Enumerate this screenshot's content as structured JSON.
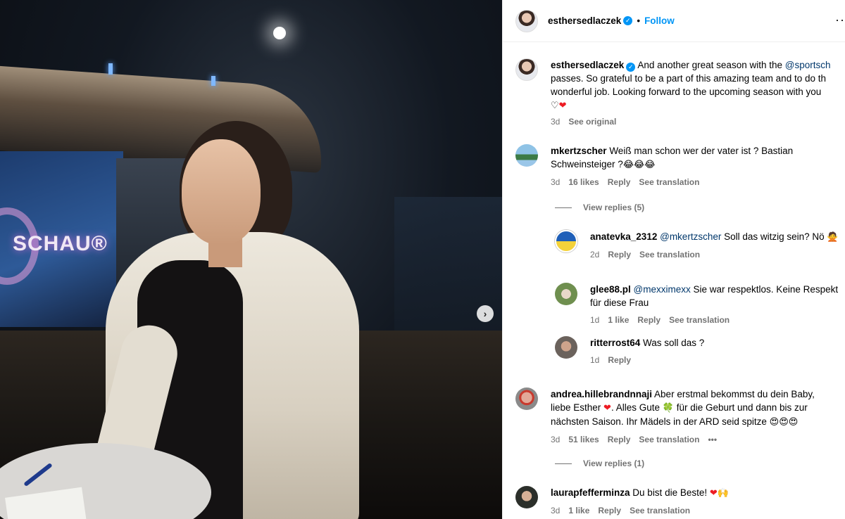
{
  "post": {
    "author": "esthersedlaczek",
    "follow_label": "Follow",
    "dot": "•",
    "more": "···",
    "next_arrow": "›"
  },
  "photo": {
    "logo_text": "SCHAU®"
  },
  "caption": {
    "username": "esthersedlaczek",
    "text_1": "And another great season with the ",
    "mention": "@sportsch",
    "text_2": "passes. So grateful to be a part of this amazing team and to do th",
    "text_3": "wonderful job. Looking forward to the upcoming season with you",
    "emoji": "♡",
    "emoji2": "❤",
    "time": "3d",
    "see_original": "See original"
  },
  "comments": [
    {
      "username": "mkertzscher",
      "text": "Weiß man schon wer der vater ist ? Bastian Schweinsteiger ?",
      "emoji": "😂😂😂",
      "time": "3d",
      "likes": "16 likes",
      "reply": "Reply",
      "translate": "See translation",
      "view_replies": "View replies (5)"
    },
    {
      "username": "andrea.hillebrandnnaji",
      "text_1": "Aber erstmal bekommst du dein Baby, liebe Esther ",
      "heart": "❤",
      "text_2": ". Alles Gute ",
      "clover": "🍀",
      "text_3": " für die Geburt und dann bis zur nächsten Saison. Ihr Mädels in der ARD seid spitze ",
      "emoji": "😍😍😍",
      "time": "3d",
      "likes": "51 likes",
      "reply": "Reply",
      "translate": "See translation",
      "more": "•••",
      "view_replies": "View replies (1)"
    },
    {
      "username": "laurapfefferminza",
      "text": "Du bist die Beste! ",
      "heart": "❤",
      "emoji": "🙌",
      "time": "3d",
      "likes": "1 like",
      "reply": "Reply",
      "translate": "See translation"
    }
  ],
  "replies": [
    {
      "username": "anatevka_2312",
      "mention": "@mkertzscher",
      "text": " Soll das witzig sein? Nö ",
      "emoji": "🙅",
      "time": "2d",
      "reply": "Reply",
      "translate": "See translation"
    },
    {
      "username": "glee88.pl",
      "mention": "@mexximexx",
      "text": " Sie war respektlos. Keine Respekt für diese Frau",
      "time": "1d",
      "likes": "1 like",
      "reply": "Reply",
      "translate": "See translation"
    },
    {
      "username": "ritterrost64",
      "text": " Was soll das ?",
      "time": "1d",
      "reply": "Reply"
    }
  ]
}
